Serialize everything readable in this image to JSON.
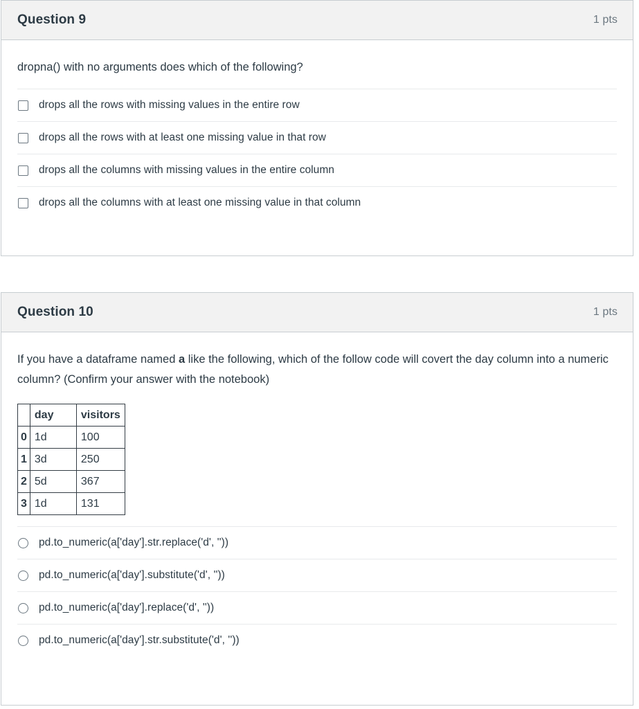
{
  "questions": [
    {
      "title": "Question 9",
      "points": "1 pts",
      "prompt": "dropna() with no arguments does which of the following?",
      "input_type": "checkbox",
      "options": [
        "drops all the rows with missing values in the entire row",
        "drops all the rows with at least one missing value in that row",
        "drops all the columns with missing values in the entire column",
        "drops all the columns with at least one missing value in that column"
      ]
    },
    {
      "title": "Question 10",
      "points": "1 pts",
      "prompt_part1": "If you have a dataframe named ",
      "prompt_bold": "a",
      "prompt_part2": " like the following, which of the follow code will covert the day column into a numeric column? (Confirm your answer with the notebook)",
      "input_type": "radio",
      "table": {
        "corner": "",
        "columns": [
          "day",
          "visitors"
        ],
        "rows": [
          {
            "index": "0",
            "day": "1d",
            "visitors": "100"
          },
          {
            "index": "1",
            "day": "3d",
            "visitors": "250"
          },
          {
            "index": "2",
            "day": "5d",
            "visitors": "367"
          },
          {
            "index": "3",
            "day": "1d",
            "visitors": "131"
          }
        ]
      },
      "options": [
        "pd.to_numeric(a['day'].str.replace('d', ''))",
        "pd.to_numeric(a['day'].substitute('d', ''))",
        "pd.to_numeric(a['day'].replace('d', ''))",
        "pd.to_numeric(a['day'].str.substitute('d', ''))"
      ]
    }
  ],
  "colors": {
    "header_background": "#f2f2f2",
    "card_border": "#c7cdd1",
    "text": "#2d3b45",
    "muted_text": "#6b7780",
    "divider": "#e8eaec"
  }
}
